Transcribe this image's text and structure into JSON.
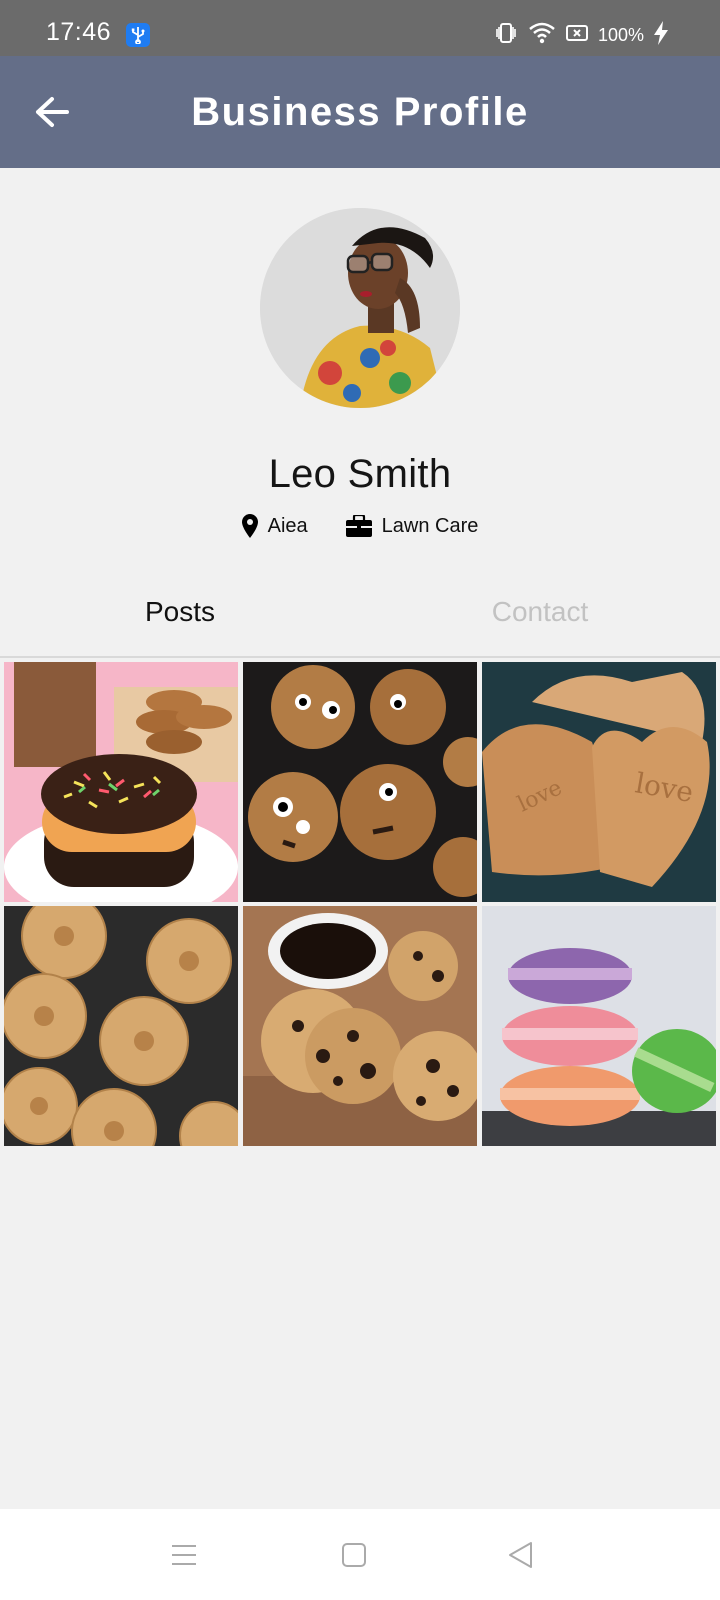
{
  "status_bar": {
    "time": "17:46",
    "battery": "100%",
    "icons": [
      "usb-icon",
      "vibrate-icon",
      "wifi-icon",
      "no-sim-icon",
      "battery-percent-text",
      "charging-bolt-icon"
    ]
  },
  "app_bar": {
    "title": "Business Profile",
    "back_icon": "arrow-left-icon",
    "background": "#646e88"
  },
  "profile": {
    "name": "Leo Smith",
    "location": "Aiea",
    "category": "Lawn Care",
    "location_icon": "map-pin-icon",
    "category_icon": "briefcase-icon"
  },
  "tabs": [
    {
      "label": "Posts",
      "active": true
    },
    {
      "label": "Contact",
      "active": false
    }
  ],
  "posts": [
    {
      "subject": "chocolate sprinkle donut with cookies and coffee"
    },
    {
      "subject": "googly-eyed oatmeal cookies"
    },
    {
      "subject": "heart-shaped love cookies"
    },
    {
      "subject": "piped butter cookies"
    },
    {
      "subject": "chocolate chip cookies with coffee"
    },
    {
      "subject": "stacked macarons"
    }
  ],
  "nav_bar": {
    "icons": [
      "menu-lines-icon",
      "home-square-icon",
      "back-triangle-icon"
    ]
  }
}
